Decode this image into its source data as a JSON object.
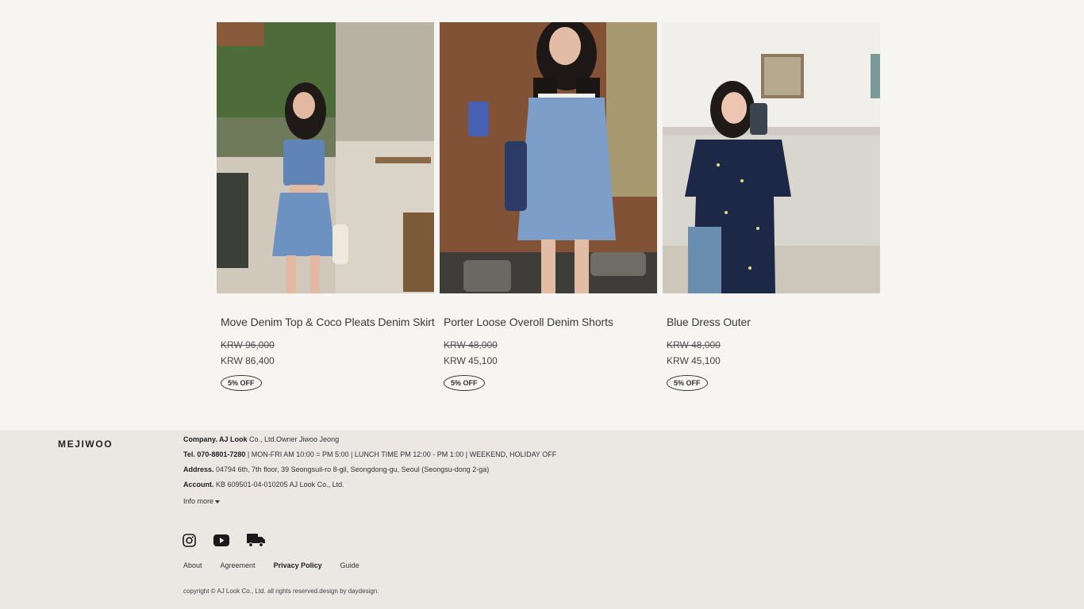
{
  "products": [
    {
      "name": "Move Denim Top & Coco Pleats Denim Skirt",
      "price_original": "KRW 96,000",
      "price_sale": "KRW 86,400",
      "badge": "5% OFF"
    },
    {
      "name": "Porter Loose Overoll Denim Shorts",
      "price_original": "KRW 48,000",
      "price_sale": "KRW 45,100",
      "badge": "5% OFF"
    },
    {
      "name": "Blue Dress Outer",
      "price_original": "KRW 48,000",
      "price_sale": "KRW 45,100",
      "badge": "5% OFF"
    }
  ],
  "footer": {
    "brand": "MEJIWOO",
    "company_label": "Company. AJ Look",
    "company_value": " Co., Ltd.Owner Jiwoo Jeong",
    "tel_label": "Tel. 070-8801-7280",
    "tel_value": " | MON-FRI AM 10:00 = PM 5:00 | LUNCH TIME PM 12:00 - PM 1:00 | WEEKEND, HOLIDAY OFF",
    "address_label": "Address.",
    "address_value": " 04794 6th, 7th floor, 39 Seongsuil-ro 8-gil, Seongdong-gu, Seoul (Seongsu-dong 2-ga)",
    "account_label": "Account.",
    "account_value": " KB 609501-04-010205 AJ Look Co., Ltd.",
    "info_more": "Info more",
    "social_icons": [
      "instagram-icon",
      "youtube-icon",
      "delivery-truck-icon"
    ],
    "links": [
      "About",
      "Agreement",
      "Privacy Policy",
      "Guide"
    ],
    "copyright": "copyright © AJ Look Co., Ltd. all rights reserved.design by daydesign."
  }
}
